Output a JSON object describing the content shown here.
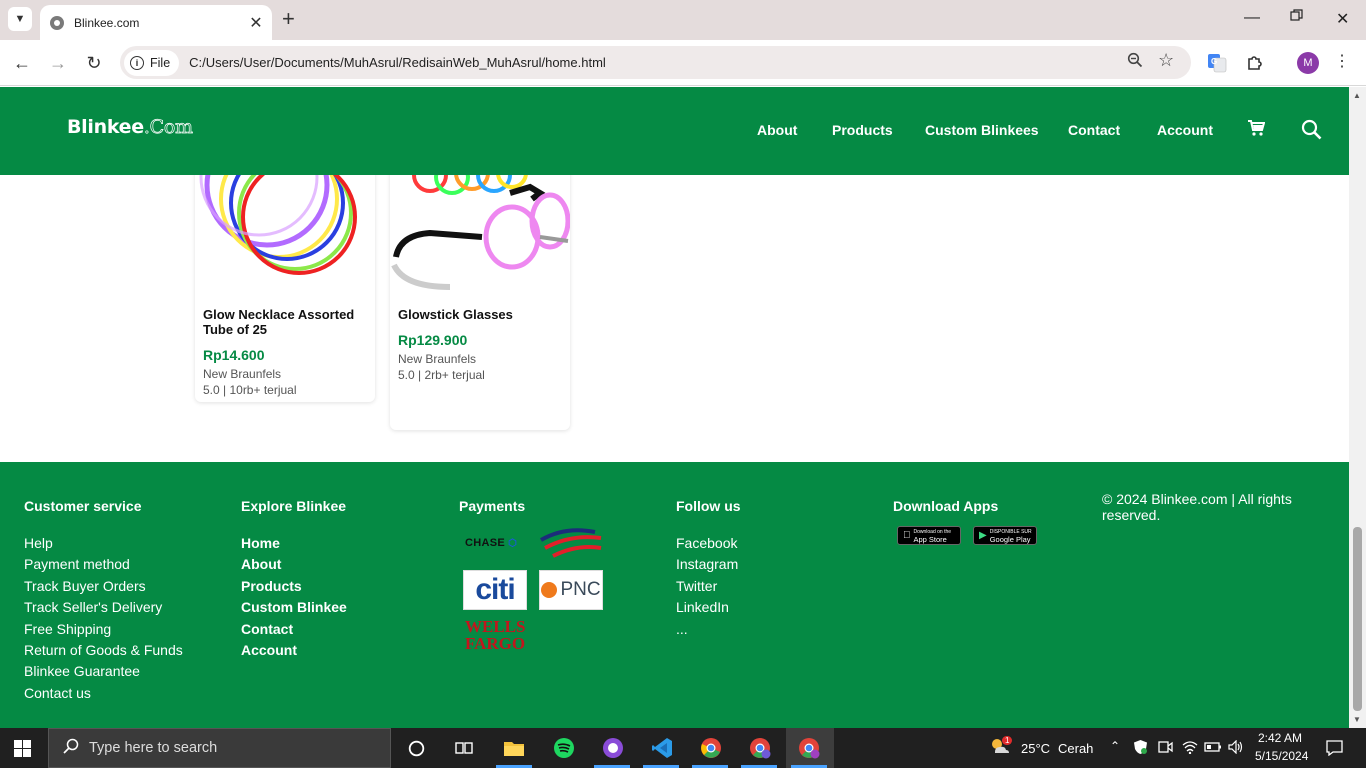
{
  "browser": {
    "tab_title": "Blinkee.com",
    "file_label": "File",
    "url": "C:/Users/User/Documents/MuhAsrul/RedisainWeb_MuhAsrul/home.html",
    "profile_initial": "M"
  },
  "site": {
    "logo_main": "Blinkee",
    "logo_dot": ".Com",
    "nav": [
      "About",
      "Products",
      "Custom Blinkees",
      "Contact",
      "Account"
    ]
  },
  "products": [
    {
      "name": "Glow Necklace Assorted Tube of 25",
      "price": "Rp14.600",
      "location": "New Braunfels",
      "stats": "5.0 | 10rb+ terjual"
    },
    {
      "name": "Glowstick Glasses",
      "price": "Rp129.900",
      "location": "New Braunfels",
      "stats": "5.0 | 2rb+ terjual"
    }
  ],
  "footer": {
    "customer_service": {
      "title": "Customer service",
      "links": [
        "Help",
        "Payment method",
        "Track Buyer Orders",
        "Track Seller's Delivery",
        "Free Shipping",
        "Return of Goods & Funds",
        "Blinkee Guarantee",
        "Contact us"
      ]
    },
    "explore": {
      "title": "Explore Blinkee",
      "links": [
        "Home",
        "About",
        "Products",
        "Custom Blinkee",
        "Contact",
        "Account"
      ]
    },
    "payments": {
      "title": "Payments",
      "logos": {
        "chase": "CHASE",
        "citi": "citi",
        "pnc": "PNC",
        "wells_line1": "WELLS",
        "wells_line2": "FARGO"
      }
    },
    "follow": {
      "title": "Follow us",
      "links": [
        "Facebook",
        "Instagram",
        "Twitter",
        "LinkedIn",
        "..."
      ]
    },
    "apps": {
      "title": "Download Apps",
      "appstore_small": "Download on the",
      "appstore": "App Store",
      "googleplay_small": "DISPONIBLE SUR",
      "googleplay": "Google Play"
    },
    "copyright": "© 2024 Blinkee.com | All rights reserved."
  },
  "taskbar": {
    "search_placeholder": "Type here to search",
    "weather_temp": "25°C",
    "weather_text": "Cerah",
    "weather_badge": "1",
    "time": "2:42 AM",
    "date": "5/15/2024"
  },
  "colors": {
    "brand_green": "#058a44",
    "taskbar": "#202020"
  }
}
